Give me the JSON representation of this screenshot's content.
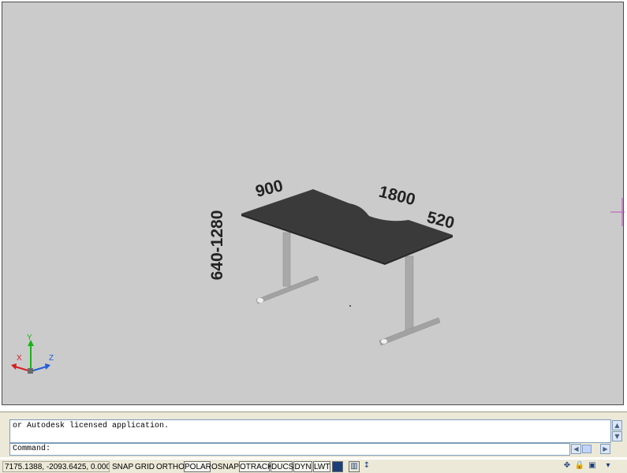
{
  "viewport": {
    "dimensions": {
      "top_width": "900",
      "length": "1800",
      "depth": "520",
      "height_range": "640-1280"
    },
    "ucs": {
      "x_label": "X",
      "y_label": "Y",
      "z_label": "Z"
    }
  },
  "command": {
    "history_line": "or Autodesk licensed application.",
    "prompt": "Command:"
  },
  "status": {
    "coordinates": "7175.1388, -2093.6425, 0.0000",
    "toggles": [
      {
        "label": "SNAP",
        "on": false
      },
      {
        "label": "GRID",
        "on": false
      },
      {
        "label": "ORTHO",
        "on": false
      },
      {
        "label": "POLAR",
        "on": true
      },
      {
        "label": "OSNAP",
        "on": false
      },
      {
        "label": "OTRACK",
        "on": true
      },
      {
        "label": "DUCS",
        "on": true
      },
      {
        "label": "DYN",
        "on": true
      },
      {
        "label": "LWT",
        "on": true
      }
    ]
  },
  "colors": {
    "viewport_bg": "#cbcbcb",
    "desk_top": "#3a3a3a",
    "desk_leg": "#a9a9a9",
    "ucs_x": "#d42020",
    "ucs_y": "#19b319",
    "ucs_z": "#2060d8"
  },
  "icons": [
    "scroll-up-icon",
    "scroll-down-icon",
    "scroll-left-icon",
    "scroll-right-icon",
    "model-icon",
    "layout-icon",
    "pan-icon",
    "lock-icon",
    "tray-settings-icon",
    "menu-arrow-icon"
  ]
}
